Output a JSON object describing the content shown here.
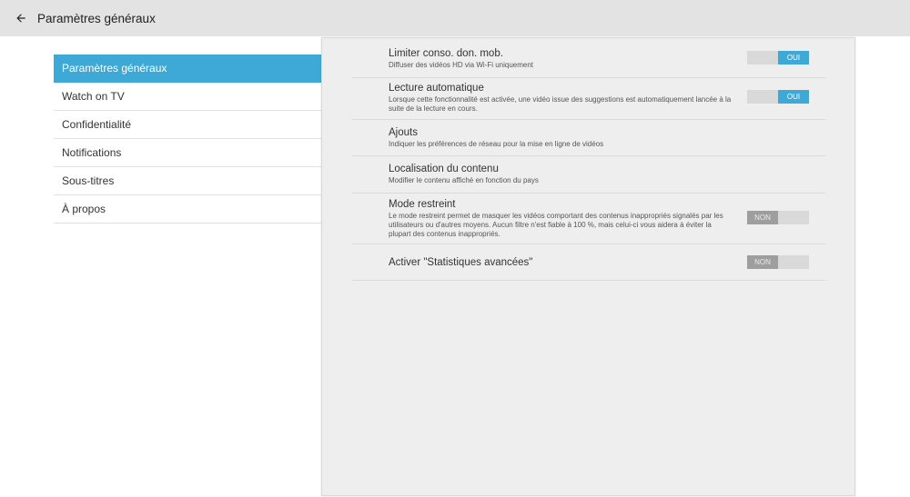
{
  "header": {
    "title": "Paramètres généraux",
    "back_icon": "arrow-left-icon"
  },
  "sidebar": {
    "items": [
      {
        "label": "Paramètres généraux",
        "active": true
      },
      {
        "label": "Watch on TV"
      },
      {
        "label": "Confidentialité"
      },
      {
        "label": "Notifications"
      },
      {
        "label": "Sous-titres"
      },
      {
        "label": "À propos"
      }
    ]
  },
  "settings": [
    {
      "title": "Limiter conso. don. mob.",
      "desc": "Diffuser des vidéos HD via Wi-Fi uniquement",
      "toggle": "OUI"
    },
    {
      "title": "Lecture automatique",
      "desc": "Lorsque cette fonctionnalité est activée, une vidéo issue des suggestions est automatiquement lancée à la suite de la lecture en cours.",
      "toggle": "OUI"
    },
    {
      "title": "Ajouts",
      "desc": "Indiquer les préférences de réseau pour la mise en ligne de vidéos"
    },
    {
      "title": "Localisation du contenu",
      "desc": "Modifier le contenu affiché en fonction du pays"
    },
    {
      "title": "Mode restreint",
      "desc": "Le mode restreint permet de masquer les vidéos comportant des contenus inappropriés signalés par les utilisateurs ou d'autres moyens. Aucun filtre n'est fiable à 100 %, mais celui-ci vous aidera à éviter la plupart des contenus inappropriés.",
      "toggle": "NON"
    },
    {
      "title": "Activer \"Statistiques avancées\"",
      "desc": "",
      "toggle": "NON"
    }
  ],
  "colors": {
    "accent": "#3ea9d6",
    "topbar": "#e3e3e3",
    "panel": "#eeeeee"
  }
}
